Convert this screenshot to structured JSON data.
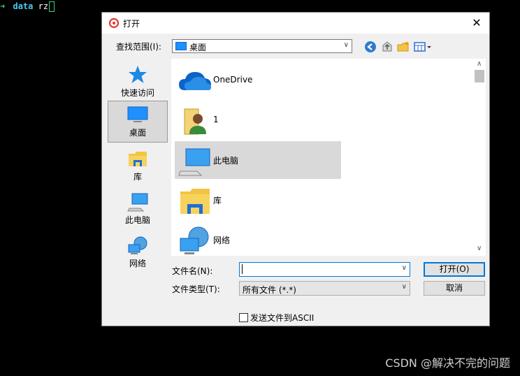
{
  "terminal": {
    "prompt_icon": "arrow-right-icon",
    "command": "data",
    "argument": "rz"
  },
  "dialog": {
    "title": "打开",
    "close_label": "✕",
    "lookin_label": "查找范围(I):",
    "lookin_value": "桌面",
    "places": [
      {
        "label": "快速访问",
        "icon": "star-icon"
      },
      {
        "label": "桌面",
        "icon": "desktop-icon"
      },
      {
        "label": "库",
        "icon": "library-folder-icon"
      },
      {
        "label": "此电脑",
        "icon": "computer-icon"
      },
      {
        "label": "网络",
        "icon": "network-icon"
      }
    ],
    "items": [
      {
        "name": "OneDrive",
        "icon": "cloud-icon"
      },
      {
        "name": "1",
        "icon": "user-folder-icon"
      },
      {
        "name": "此电脑",
        "icon": "computer-icon"
      },
      {
        "name": "库",
        "icon": "library-folder-icon"
      },
      {
        "name": "网络",
        "icon": "network-icon"
      }
    ],
    "filename_label": "文件名(N):",
    "filename_value": "",
    "filetype_label": "文件类型(T):",
    "filetype_value": "所有文件 (*.*)",
    "open_button": "打开(O)",
    "cancel_button": "取消",
    "ascii_checkbox_label": "发送文件到ASCII"
  },
  "watermark": "CSDN @解决不完的问题",
  "colors": {
    "selection": "#d9d9d9",
    "focus": "#0078d7",
    "background": "#000000"
  }
}
